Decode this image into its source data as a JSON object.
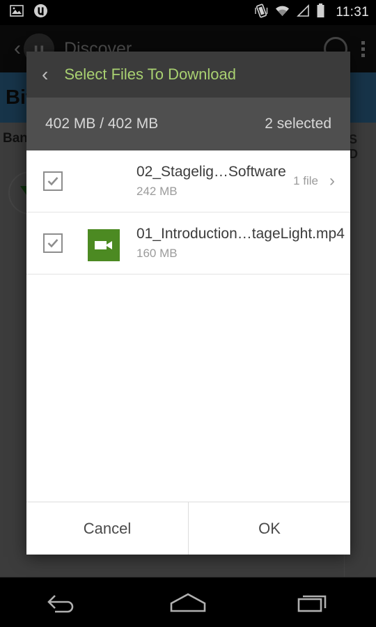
{
  "status_bar": {
    "icons": [
      "image-icon",
      "utorrent-notification-icon",
      "vibrate-icon",
      "wifi-icon",
      "cell-signal-icon",
      "battery-icon"
    ],
    "clock": "11:31"
  },
  "background_app": {
    "back_label": "‹",
    "logo_letter": "μ",
    "title": "Discover",
    "search_icon": "search-icon",
    "overflow_icon": "overflow-menu-icon",
    "blue_bar_text": "Bit",
    "row_text": "Band",
    "side_labels": [
      "S",
      "D"
    ]
  },
  "dialog": {
    "back_chevron": "‹",
    "title": "Select Files To Download",
    "size_summary": "402 MB / 402 MB",
    "selected_summary": "2 selected",
    "rows": [
      {
        "checked": true,
        "icon": "folder-icon",
        "name": "02_Stagelig…Software",
        "size": "242 MB",
        "count": "1 file",
        "chevron": "›"
      },
      {
        "checked": true,
        "icon": "video-file-icon",
        "name": "01_Introduction…tageLight.mp4",
        "size": "160 MB",
        "count": "",
        "chevron": ""
      }
    ],
    "cancel_label": "Cancel",
    "ok_label": "OK"
  },
  "nav_bar": {
    "back": "back-nav-icon",
    "home": "home-nav-icon",
    "recents": "recents-nav-icon"
  },
  "colors": {
    "accent_green": "#a9d171",
    "video_green": "#4c8a22",
    "dialog_header": "#3b3b3b",
    "dialog_subheader": "#4f4f4f"
  }
}
